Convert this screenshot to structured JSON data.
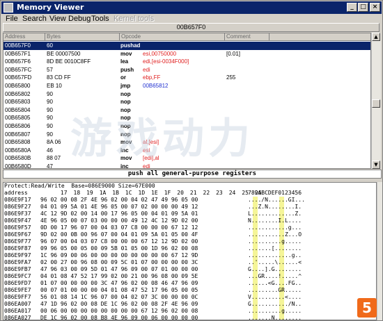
{
  "window": {
    "title": "Memory Viewer",
    "minimize": "_",
    "maximize": "□",
    "close": "×"
  },
  "menu": [
    "File",
    "Search",
    "View",
    "Debug",
    "Tools"
  ],
  "menu_disabled": "Kernel tools",
  "current_address": "00B657F0",
  "disassembly": {
    "headers": [
      "Address",
      "Bytes",
      "Opcode",
      "Comment"
    ],
    "rows": [
      {
        "address": "00B657F0",
        "bytes": "60",
        "op": "pushad",
        "args": "",
        "comment": ""
      },
      {
        "address": "00B657F1",
        "bytes": "BE 00007500",
        "op": "mov",
        "args": "esi,00750000",
        "comment": "[0.01]"
      },
      {
        "address": "00B657F6",
        "bytes": "8D BE 0010C8FF",
        "op": "lea",
        "args": "edi,[esi-0034F000]",
        "comment": ""
      },
      {
        "address": "00B657FC",
        "bytes": "57",
        "op": "push",
        "args": "edi",
        "comment": ""
      },
      {
        "address": "00B657FD",
        "bytes": "83 CD FF",
        "op": "or",
        "args": "ebp,FF",
        "comment": "255"
      },
      {
        "address": "00B65800",
        "bytes": "EB 10",
        "op": "jmp",
        "args": "00B65812",
        "comment": ""
      },
      {
        "address": "00B65802",
        "bytes": "90",
        "op": "nop",
        "args": "",
        "comment": ""
      },
      {
        "address": "00B65803",
        "bytes": "90",
        "op": "nop",
        "args": "",
        "comment": ""
      },
      {
        "address": "00B65804",
        "bytes": "90",
        "op": "nop",
        "args": "",
        "comment": ""
      },
      {
        "address": "00B65805",
        "bytes": "90",
        "op": "nop",
        "args": "",
        "comment": ""
      },
      {
        "address": "00B65806",
        "bytes": "90",
        "op": "nop",
        "args": "",
        "comment": ""
      },
      {
        "address": "00B65807",
        "bytes": "90",
        "op": "nop",
        "args": "",
        "comment": ""
      },
      {
        "address": "00B65808",
        "bytes": "8A 06",
        "op": "mov",
        "args": "al,[esi]",
        "comment": ""
      },
      {
        "address": "00B6580A",
        "bytes": "46",
        "op": "inc",
        "args": "esi",
        "comment": ""
      },
      {
        "address": "00B6580B",
        "bytes": "88 07",
        "op": "mov",
        "args": "[edi],al",
        "comment": ""
      },
      {
        "address": "00B6580D",
        "bytes": "47",
        "op": "inc",
        "args": "edi",
        "comment": ""
      }
    ]
  },
  "instruction_description": "push all general-purpose registers",
  "hex": {
    "status": "Protect:Read/Write  Base=086E9000 Size=67E000",
    "header_label": "address",
    "header_cols": [
      "17",
      "18",
      "19",
      "1A",
      "1B",
      "1C",
      "1D",
      "1E",
      "1F",
      "20",
      "21",
      "22",
      "23",
      "24",
      "25",
      "26"
    ],
    "header_ascii": "789ABCDEF0123456",
    "rows": [
      {
        "addr": "086E9F17",
        "bytes": "96 02 00 08 2F 4E 96 02 00 04 02 47 49 96 05 00",
        "ascii": "..../N......GI..."
      },
      {
        "addr": "086E9F27",
        "bytes": "04 01 09 5A 01 4E 96 05 00 07 02 00 00 00 49 12",
        "ascii": "...Z.N........I."
      },
      {
        "addr": "086E9F37",
        "bytes": "4C 12 9D 02 00 14 00 17 96 05 00 04 01 09 5A 01",
        "ascii": "L.............Z."
      },
      {
        "addr": "086E9F47",
        "bytes": "4E 96 05 00 07 03 00 00 00 49 12 4C 12 9D 02 00",
        "ascii": "N........I.L...."
      },
      {
        "addr": "086E9F57",
        "bytes": "0D 00 17 96 07 00 04 03 07 C8 00 00 00 67 12 12",
        "ascii": "............g..."
      },
      {
        "addr": "086E9F67",
        "bytes": "9D 02 00 0B 00 96 07 00 04 01 09 5A 01 05 00 4F",
        "ascii": "...........Z...O"
      },
      {
        "addr": "086E9F77",
        "bytes": "96 07 00 04 03 07 C8 00 00 00 67 12 12 9D 02 00",
        "ascii": "..........g....."
      },
      {
        "addr": "086E9F87",
        "bytes": "09 96 05 00 05 00 09 5B 01 05 00 1D 96 02 00 08",
        "ascii": ".......[........"
      },
      {
        "addr": "086E9F97",
        "bytes": "1C 96 09 00 06 00 00 00 00 00 00 00 00 67 12 9D",
        "ascii": ".............g.."
      },
      {
        "addr": "086E9FA7",
        "bytes": "02 00 27 00 96 08 00 09 5C 01 07 00 00 00 00 3C",
        "ascii": "..'.....\\......<"
      },
      {
        "addr": "086E9FB7",
        "bytes": "47 96 03 00 09 5D 01 47 96 09 00 07 01 00 00 00",
        "ascii": "G....].G........"
      },
      {
        "addr": "086E9FC7",
        "bytes": "04 01 08 47 52 17 99 02 00 21 00 96 08 00 09 5E",
        "ascii": "...GR....!.....^"
      },
      {
        "addr": "086E9FD7",
        "bytes": "01 07 00 00 00 00 3C 47 96 02 00 08 46 47 96 09",
        "ascii": "......<G....FG.."
      },
      {
        "addr": "086E9FE7",
        "bytes": "00 07 01 00 00 00 04 01 08 47 52 17 96 05 00 05",
        "ascii": ".........GR....."
      },
      {
        "addr": "086E9FF7",
        "bytes": "56 01 08 14 1C 96 07 00 04 02 07 3C 00 00 00 0C",
        "ascii": "V..........<...."
      },
      {
        "addr": "086EA007",
        "bytes": "47 1D 96 02 00 08 DE 1C 96 02 00 08 2F 4E 96 09",
        "ascii": "G.........../N.."
      },
      {
        "addr": "086EA017",
        "bytes": "00 06 00 00 00 00 00 00 00 00 67 12 96 02 00 08",
        "ascii": "..........g....."
      },
      {
        "addr": "086EA027",
        "bytes": "DE 1C 96 02 00 08 B8 4E 96 09 00 06 00 00 00 00",
        "ascii": ".......N........"
      }
    ]
  },
  "watermark_text": "游戏动力",
  "corner_badge": "5"
}
